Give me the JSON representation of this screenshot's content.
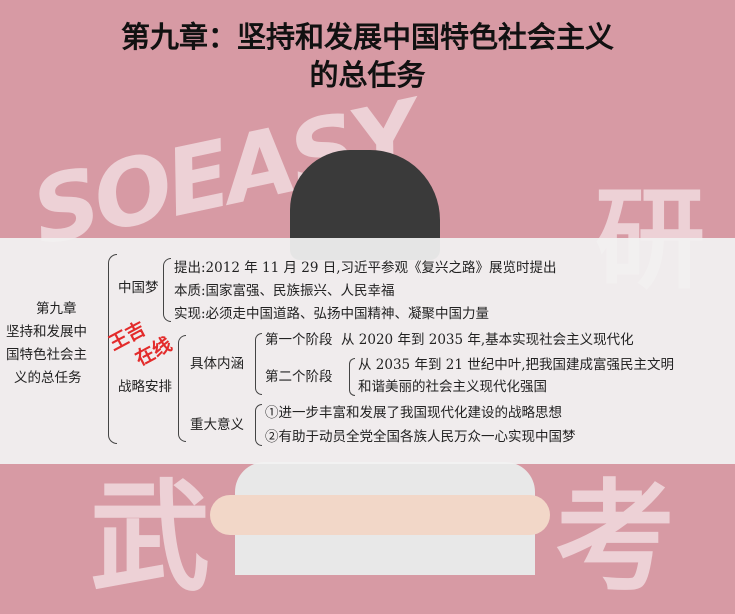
{
  "title": {
    "line1": "第九章：坚持和发展中国特色社会主义",
    "line2": "的总任务"
  },
  "background": {
    "deco_text": [
      "SOEASY",
      "研",
      "武",
      "考"
    ]
  },
  "stamp": {
    "line1": "王吉",
    "line2": "在线",
    "color": "#e32b2b"
  },
  "mindmap": {
    "root": {
      "line1": "第九章",
      "line2": "坚持和发展中",
      "line3": "国特色社会主",
      "line4": "义的总任务"
    },
    "zhongguomeng": {
      "label": "中国梦",
      "items": [
        "提出:2012 年 11 月 29 日,习近平参观《复兴之路》展览时提出",
        "本质:国家富强、民族振兴、人民幸福",
        "实现:必须走中国道路、弘扬中国精神、凝聚中国力量"
      ]
    },
    "zhanlue": {
      "label": "战略安排",
      "juti": {
        "label": "具体内涵",
        "stage1": {
          "label": "第一个阶段",
          "text": "从 2020 年到 2035 年,基本实现社会主义现代化"
        },
        "stage2": {
          "label": "第二个阶段",
          "text1": "从 2035 年到 21 世纪中叶,把我国建成富强民主文明",
          "text2": "和谐美丽的社会主义现代化强国"
        }
      },
      "zhongda": {
        "label": "重大意义",
        "items": [
          "①进一步丰富和发展了我国现代化建设的战略思想",
          "②有助于动员全党全国各族人民万众一心实现中国梦"
        ]
      }
    }
  }
}
